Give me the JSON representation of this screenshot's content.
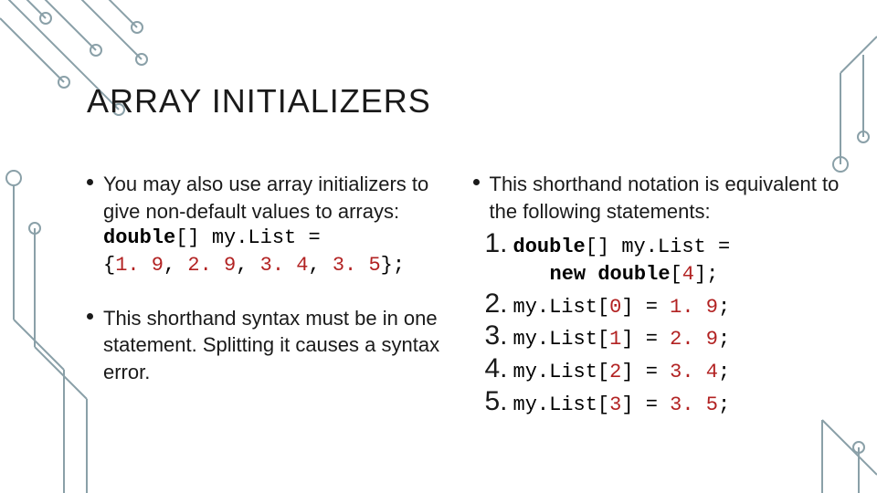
{
  "title": "ARRAY INITIALIZERS",
  "left": {
    "b1_text": "You may also use array initializers to give non-default values to arrays:",
    "code1_kw": "double",
    "code1_rest": "[] my.List =",
    "code2_a": "  {",
    "code2_n1": "1. 9",
    "code2_c1": ", ",
    "code2_n2": "2. 9",
    "code2_c2": ", ",
    "code2_n3": "3. 4",
    "code2_c3": ", ",
    "code2_n4": "3. 5",
    "code2_b": "};",
    "b2_text": "This shorthand syntax must be in one statement. Splitting it causes a syntax error."
  },
  "right": {
    "b1_text": "This shorthand notation is equivalent to the following statements:",
    "items": {
      "n1": "1.",
      "l1a": "double",
      "l1b": "[] my.List =",
      "l1c_a": "new ",
      "l1c_b": "double",
      "l1c_c": "[",
      "l1c_n": "4",
      "l1c_d": "];",
      "n2": "2.",
      "l2a": "my.List[",
      "l2n0": "0",
      "l2b": "] = ",
      "l2v": "1. 9",
      "l2c": ";",
      "n3": "3.",
      "l3a": "my.List[",
      "l3n0": "1",
      "l3b": "] = ",
      "l3v": "2. 9",
      "l3c": ";",
      "n4": "4.",
      "l4a": "my.List[",
      "l4n0": "2",
      "l4b": "] = ",
      "l4v": "3. 4",
      "l4c": ";",
      "n5": "5.",
      "l5a": "my.List[",
      "l5n0": "3",
      "l5b": "] = ",
      "l5v": "3. 5",
      "l5c": ";"
    }
  }
}
